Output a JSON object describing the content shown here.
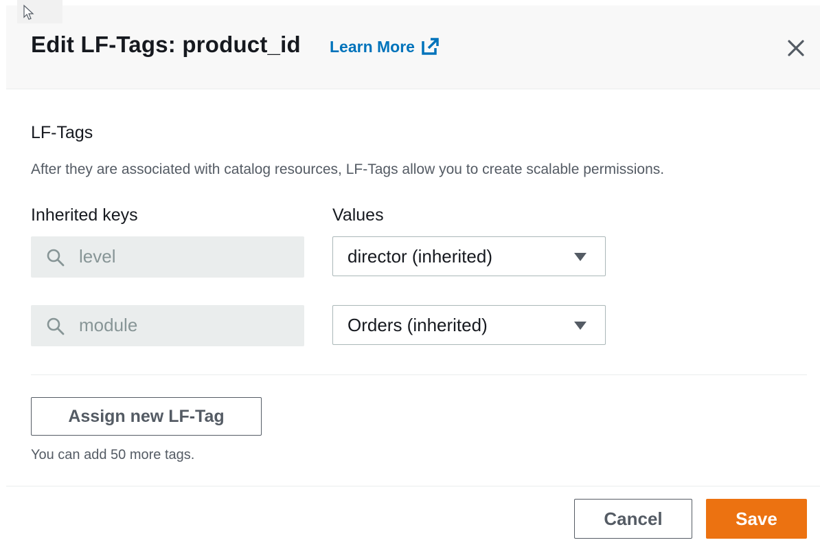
{
  "header": {
    "title": "Edit LF-Tags: product_id",
    "learn_more": "Learn More",
    "learn_more_icon": "external-link-icon",
    "close_icon": "close-icon"
  },
  "section": {
    "title": "LF-Tags",
    "description": "After they are associated with catalog resources, LF-Tags allow you to create scalable permissions."
  },
  "columns": {
    "keys_label": "Inherited keys",
    "values_label": "Values"
  },
  "tags": [
    {
      "key": "level",
      "value": "director (inherited)"
    },
    {
      "key": "module",
      "value": "Orders (inherited)"
    }
  ],
  "actions": {
    "assign_label": "Assign new LF-Tag",
    "hint": "You can add 50 more tags."
  },
  "footer": {
    "cancel_label": "Cancel",
    "save_label": "Save"
  },
  "colors": {
    "accent": "#ec7211",
    "link": "#0073bb",
    "disabled_bg": "#eaeded"
  }
}
